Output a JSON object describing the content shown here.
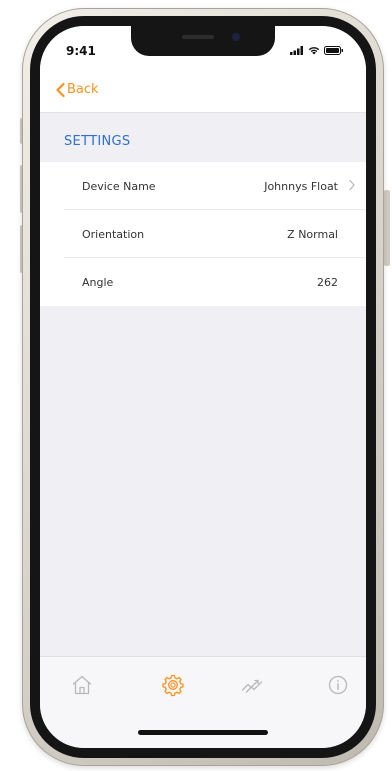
{
  "status_bar": {
    "time": "9:41"
  },
  "nav": {
    "back_label": "Back"
  },
  "section": {
    "title": "SETTINGS"
  },
  "settings": [
    {
      "label": "Device Name",
      "value": "Johnnys Float",
      "has_chevron": true
    },
    {
      "label": "Orientation",
      "value": "Z Normal",
      "has_chevron": false
    },
    {
      "label": "Angle",
      "value": "262",
      "has_chevron": false
    }
  ],
  "tab_bar": {
    "tabs": [
      {
        "icon": "home-icon",
        "active": false
      },
      {
        "icon": "gear-icon",
        "active": true
      },
      {
        "icon": "activity-icon",
        "active": false
      },
      {
        "icon": "info-icon",
        "active": false
      }
    ]
  },
  "colors": {
    "accent": "#f7931e",
    "section_header": "#2f6fd1",
    "background": "#efeff4",
    "inactive_icon": "#b8b8bc"
  }
}
